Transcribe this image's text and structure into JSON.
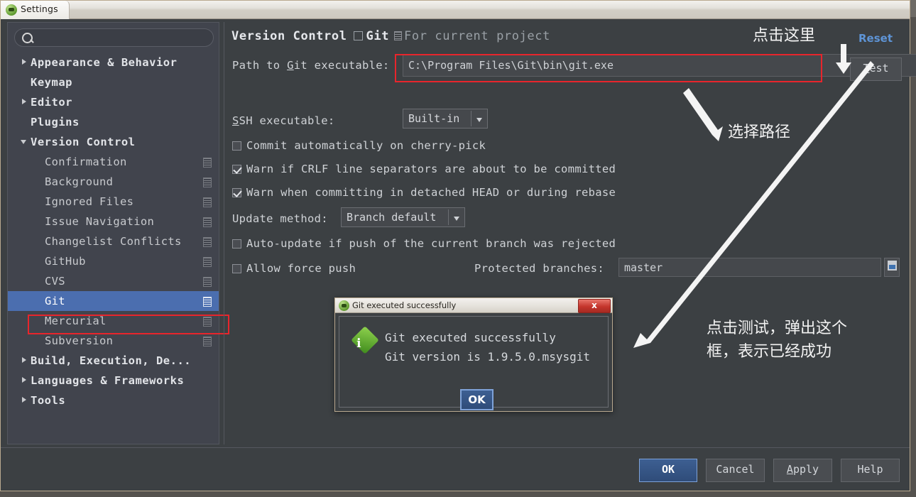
{
  "window": {
    "title": "Settings"
  },
  "sidebar": {
    "search_placeholder": "",
    "items": [
      {
        "label": "Appearance & Behavior",
        "arrow": "collapsed",
        "level": "top",
        "cfg": false,
        "selected": false
      },
      {
        "label": "Keymap",
        "arrow": "none",
        "level": "plain",
        "cfg": false,
        "selected": false
      },
      {
        "label": "Editor",
        "arrow": "collapsed",
        "level": "top",
        "cfg": false,
        "selected": false
      },
      {
        "label": "Plugins",
        "arrow": "none",
        "level": "plain",
        "cfg": false,
        "selected": false
      },
      {
        "label": "Version Control",
        "arrow": "expanded",
        "level": "top",
        "cfg": false,
        "selected": false
      },
      {
        "label": "Confirmation",
        "arrow": "none",
        "level": "child",
        "cfg": true,
        "selected": false
      },
      {
        "label": "Background",
        "arrow": "none",
        "level": "child",
        "cfg": true,
        "selected": false
      },
      {
        "label": "Ignored Files",
        "arrow": "none",
        "level": "child",
        "cfg": true,
        "selected": false
      },
      {
        "label": "Issue Navigation",
        "arrow": "none",
        "level": "child",
        "cfg": true,
        "selected": false
      },
      {
        "label": "Changelist Conflicts",
        "arrow": "none",
        "level": "child",
        "cfg": true,
        "selected": false
      },
      {
        "label": "GitHub",
        "arrow": "none",
        "level": "child",
        "cfg": true,
        "selected": false
      },
      {
        "label": "CVS",
        "arrow": "none",
        "level": "child",
        "cfg": true,
        "selected": false
      },
      {
        "label": "Git",
        "arrow": "none",
        "level": "child",
        "cfg": true,
        "selected": true
      },
      {
        "label": "Mercurial",
        "arrow": "none",
        "level": "child",
        "cfg": true,
        "selected": false
      },
      {
        "label": "Subversion",
        "arrow": "none",
        "level": "child",
        "cfg": true,
        "selected": false
      },
      {
        "label": "Build, Execution, De...",
        "arrow": "collapsed",
        "level": "top",
        "cfg": false,
        "selected": false
      },
      {
        "label": "Languages & Frameworks",
        "arrow": "collapsed",
        "level": "top",
        "cfg": false,
        "selected": false
      },
      {
        "label": "Tools",
        "arrow": "collapsed",
        "level": "top",
        "cfg": false,
        "selected": false
      }
    ]
  },
  "main": {
    "breadcrumb": "Version Control",
    "page_title": "Git",
    "scope_label": "For current project",
    "reset_label": "Reset",
    "path_label_pre": "Path to ",
    "path_label_key": "G",
    "path_label_post": "it executable:",
    "path_value": "C:\\Program Files\\Git\\bin\\git.exe",
    "browse_label": "...",
    "test_label": "Test",
    "test_mnemonic": "T",
    "ssh_label_key": "S",
    "ssh_label_rest": "SH executable:",
    "ssh_value": "Built-in",
    "cb_cherry_pick": "Commit automatically on cherry-pick",
    "cb_crlf": "Warn if CRLF line separators are about to be committed",
    "cb_detached": "Warn when committing in detached HEAD or during rebase",
    "update_method_label": "Update method:",
    "update_method_value": "Branch default",
    "cb_autoupdate": "Auto-update if push of the current branch was rejected",
    "cb_forcepush": "Allow force push",
    "protected_label": "Protected branches:",
    "protected_value": "master"
  },
  "dialog": {
    "title": "Git executed successfully",
    "message": "Git executed successfully\nGit version is 1.9.5.0.msysgit",
    "ok_label": "OK",
    "close_label": "x"
  },
  "footer": {
    "ok": "OK",
    "cancel": "Cancel",
    "apply": "Apply",
    "help": "Help"
  },
  "annotations": {
    "click_here": "点击这里",
    "choose_path": "选择路径",
    "test_note_line1": "点击测试，弹出这个",
    "test_note_line2": "框，表示已经成功"
  },
  "colors": {
    "window_bg": "#3c4043",
    "sidebar_bg": "#41444d",
    "selection": "#4b6eaf",
    "highlight_red": "#e8252c",
    "link_blue": "#5e94d6",
    "frame_tan": "#b9a98f"
  }
}
